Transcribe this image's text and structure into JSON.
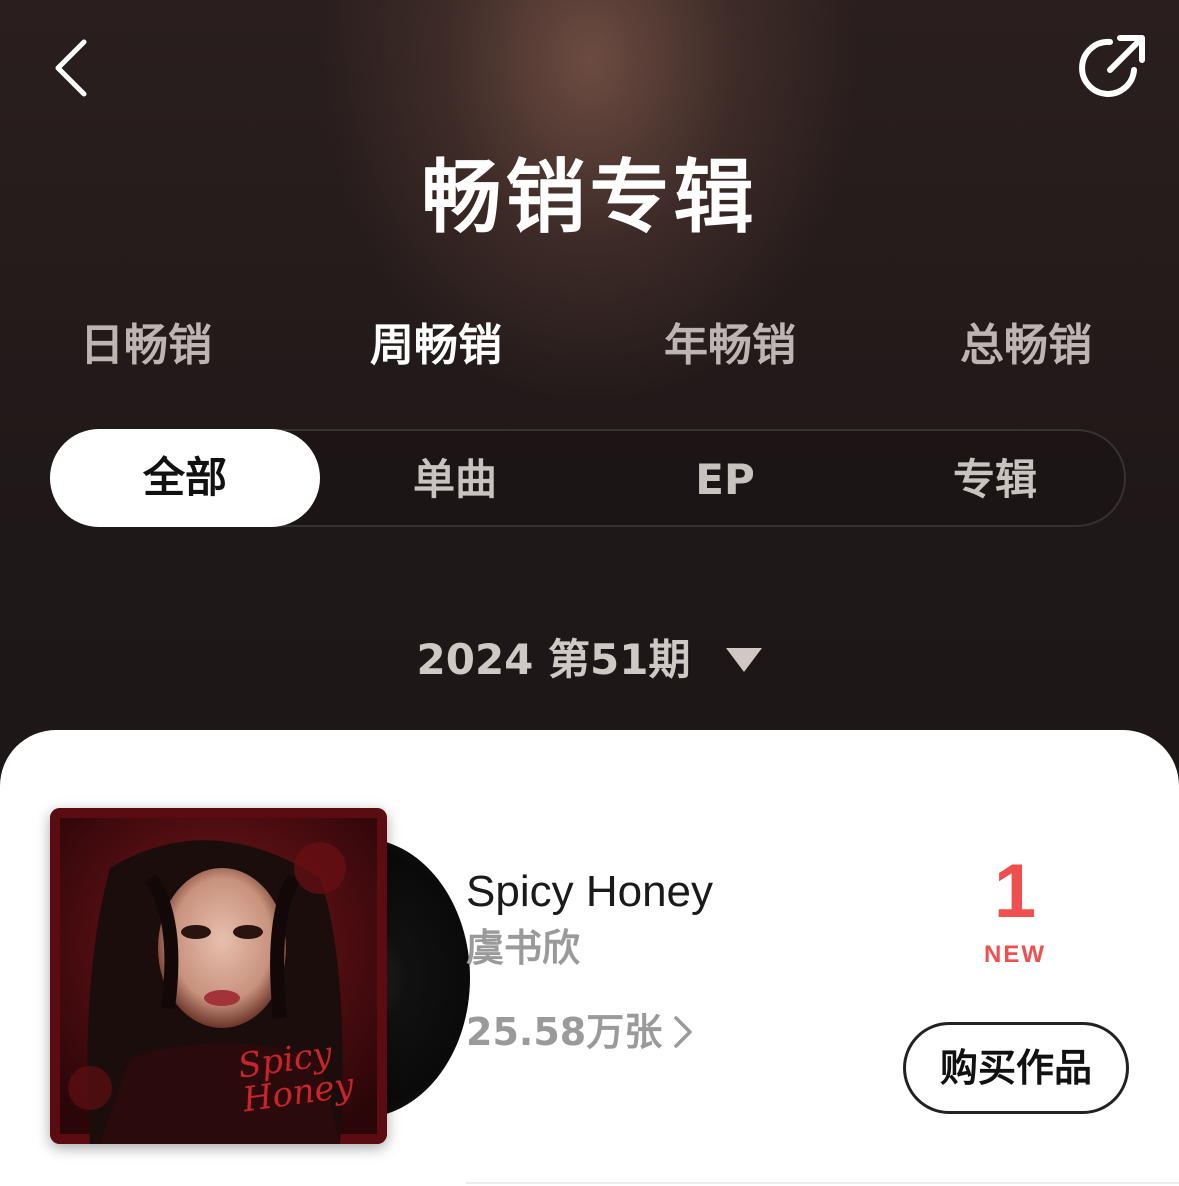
{
  "header": {
    "title": "畅销专辑"
  },
  "icons": {
    "back": "chevron-left-icon",
    "share": "share-arrow-icon",
    "caret": "triangle-down-icon",
    "sales_chevron": "chevron-right-icon"
  },
  "period_tabs": [
    {
      "label": "日畅销",
      "active": false
    },
    {
      "label": "周畅销",
      "active": true
    },
    {
      "label": "年畅销",
      "active": false
    },
    {
      "label": "总畅销",
      "active": false
    }
  ],
  "filters": [
    {
      "label": "全部",
      "active": true
    },
    {
      "label": "单曲",
      "active": false
    },
    {
      "label": "EP",
      "active": false
    },
    {
      "label": "专辑",
      "active": false
    }
  ],
  "period_selector": {
    "label": "2024 第51期"
  },
  "items": [
    {
      "title": "Spicy Honey",
      "artist": "虞书欣",
      "sales": "25.58万张",
      "rank": "1",
      "rank_badge": "NEW",
      "buy_label": "购买作品",
      "cover_text": "Spicy Honey"
    }
  ],
  "colors": {
    "accent_red": "#ef4f4f",
    "background_dark": "#1c1616"
  }
}
